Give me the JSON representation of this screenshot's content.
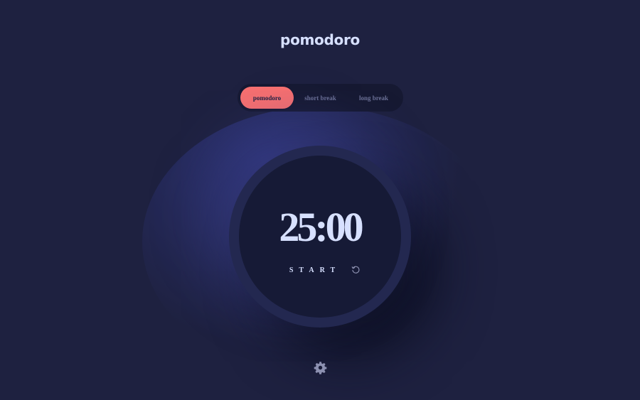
{
  "app": {
    "title": "pomodoro"
  },
  "modes": {
    "items": [
      {
        "label": "pomodoro",
        "active": true
      },
      {
        "label": "short break",
        "active": false
      },
      {
        "label": "long break",
        "active": false
      }
    ]
  },
  "timer": {
    "value": "25:00",
    "start_label": "START"
  },
  "icons": {
    "reset": "reset-icon",
    "settings": "gear-icon"
  },
  "colors": {
    "background": "#1e2140",
    "ring": "#232850",
    "face": "#161a36",
    "tabs_background": "#161932",
    "accent": "#f87070",
    "title_text": "#d7e0ff",
    "timer_text": "#d7e0ff",
    "inactive_tab_text": "#6c7196",
    "active_tab_text": "#1e2140",
    "icon": "#8c90b0",
    "glow": "#2c3273"
  }
}
